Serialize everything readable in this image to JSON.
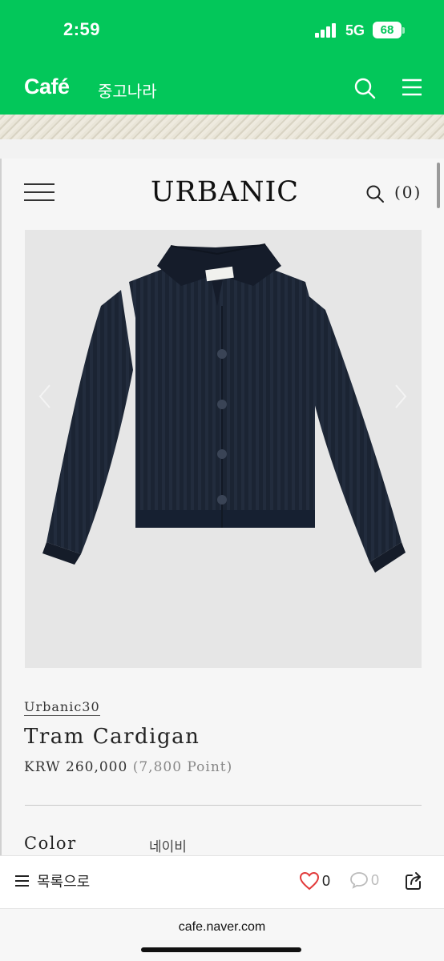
{
  "status": {
    "time": "2:59",
    "network": "5G",
    "battery": "68"
  },
  "cafe": {
    "logo": "Café",
    "name": "중고나라"
  },
  "shop": {
    "logo": "URBANIC",
    "cart": "(0)",
    "product": {
      "brand": "Urbanic30",
      "name": "Tram Cardigan",
      "price": "KRW 260,000",
      "points": "(7,800 Point)",
      "color_label": "Color",
      "color_value": "네이비",
      "garment_color": "#1b2433"
    }
  },
  "bottom": {
    "list_label": "목록으로",
    "likes": "0",
    "comments": "0"
  },
  "browser": {
    "url": "cafe.naver.com"
  },
  "colors": {
    "brand_green": "#03c75a",
    "like_red": "#e23b3b"
  }
}
